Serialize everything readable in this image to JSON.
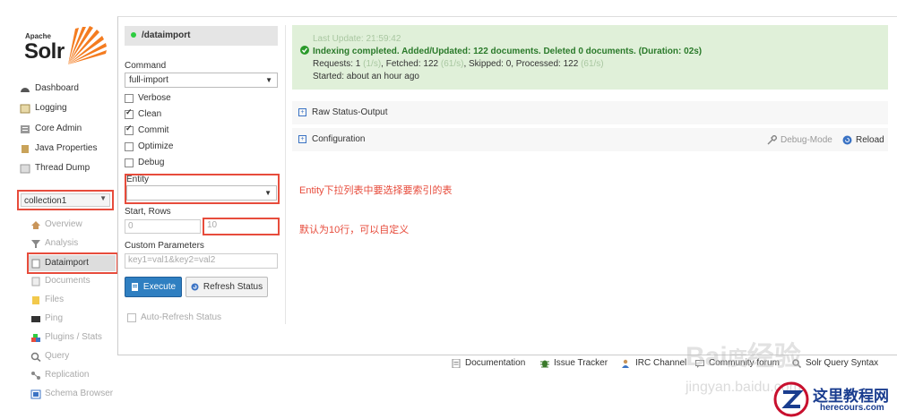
{
  "logo": {
    "apache": "Apache",
    "solr": "Solr"
  },
  "nav": [
    {
      "label": "Dashboard",
      "icon": "dashboard-icon"
    },
    {
      "label": "Logging",
      "icon": "logging-icon"
    },
    {
      "label": "Core Admin",
      "icon": "core-admin-icon"
    },
    {
      "label": "Java Properties",
      "icon": "java-properties-icon"
    },
    {
      "label": "Thread Dump",
      "icon": "thread-dump-icon"
    }
  ],
  "collection_selector": {
    "value": "collection1"
  },
  "collection_menu": [
    {
      "label": "Overview"
    },
    {
      "label": "Analysis"
    },
    {
      "label": "Dataimport"
    },
    {
      "label": "Documents"
    },
    {
      "label": "Files"
    },
    {
      "label": "Ping"
    },
    {
      "label": "Plugins / Stats"
    },
    {
      "label": "Query"
    },
    {
      "label": "Replication"
    },
    {
      "label": "Schema Browser"
    }
  ],
  "form": {
    "handler": "/dataimport",
    "command_label": "Command",
    "command_value": "full-import",
    "checkboxes": [
      {
        "label": "Verbose",
        "checked": false
      },
      {
        "label": "Clean",
        "checked": true
      },
      {
        "label": "Commit",
        "checked": true
      },
      {
        "label": "Optimize",
        "checked": false
      },
      {
        "label": "Debug",
        "checked": false
      }
    ],
    "entity_label": "Entity",
    "entity_value": "",
    "start_rows_label": "Start, Rows",
    "start_value": "0",
    "rows_value": "10",
    "custom_params_label": "Custom Parameters",
    "custom_params_placeholder": "key1=val1&key2=val2",
    "execute_label": "Execute",
    "refresh_label": "Refresh Status",
    "auto_refresh_label": "Auto-Refresh Status"
  },
  "status": {
    "last_update": "Last Update: 21:59:42",
    "headline": "Indexing completed. Added/Updated: 122 documents. Deleted 0 documents. (Duration: 02s)",
    "requests_label": "Requests: 1",
    "requests_rate": "(1/s)",
    "fetched_label": ", Fetched: 122",
    "fetched_rate": "(61/s)",
    "skipped_label": ", Skipped: 0, Processed: 122",
    "processed_rate": "(61/s)",
    "started": "Started: about an hour ago"
  },
  "sections": {
    "raw_status": "Raw Status-Output",
    "configuration": "Configuration",
    "debug_mode": "Debug-Mode",
    "reload": "Reload"
  },
  "annotations": {
    "entity_note": "Entity下拉列表中要选择要索引的表",
    "rows_note": "默认为10行，可以自定义"
  },
  "footer": [
    {
      "label": "Documentation",
      "icon": "documentation-icon"
    },
    {
      "label": "Issue Tracker",
      "icon": "bug-icon"
    },
    {
      "label": "IRC Channel",
      "icon": "irc-icon"
    },
    {
      "label": "Community forum",
      "icon": "forum-icon"
    },
    {
      "label": "Solr Query Syntax",
      "icon": "query-syntax-icon"
    }
  ],
  "watermark": {
    "text": "jingyan.baidu.com"
  },
  "brand": {
    "name": "这里教程网",
    "url": "herecours.com"
  },
  "colors": {
    "accent": "#e74c3c",
    "status_bg": "#e0f0d9",
    "primary_button": "#2f7fc1"
  }
}
